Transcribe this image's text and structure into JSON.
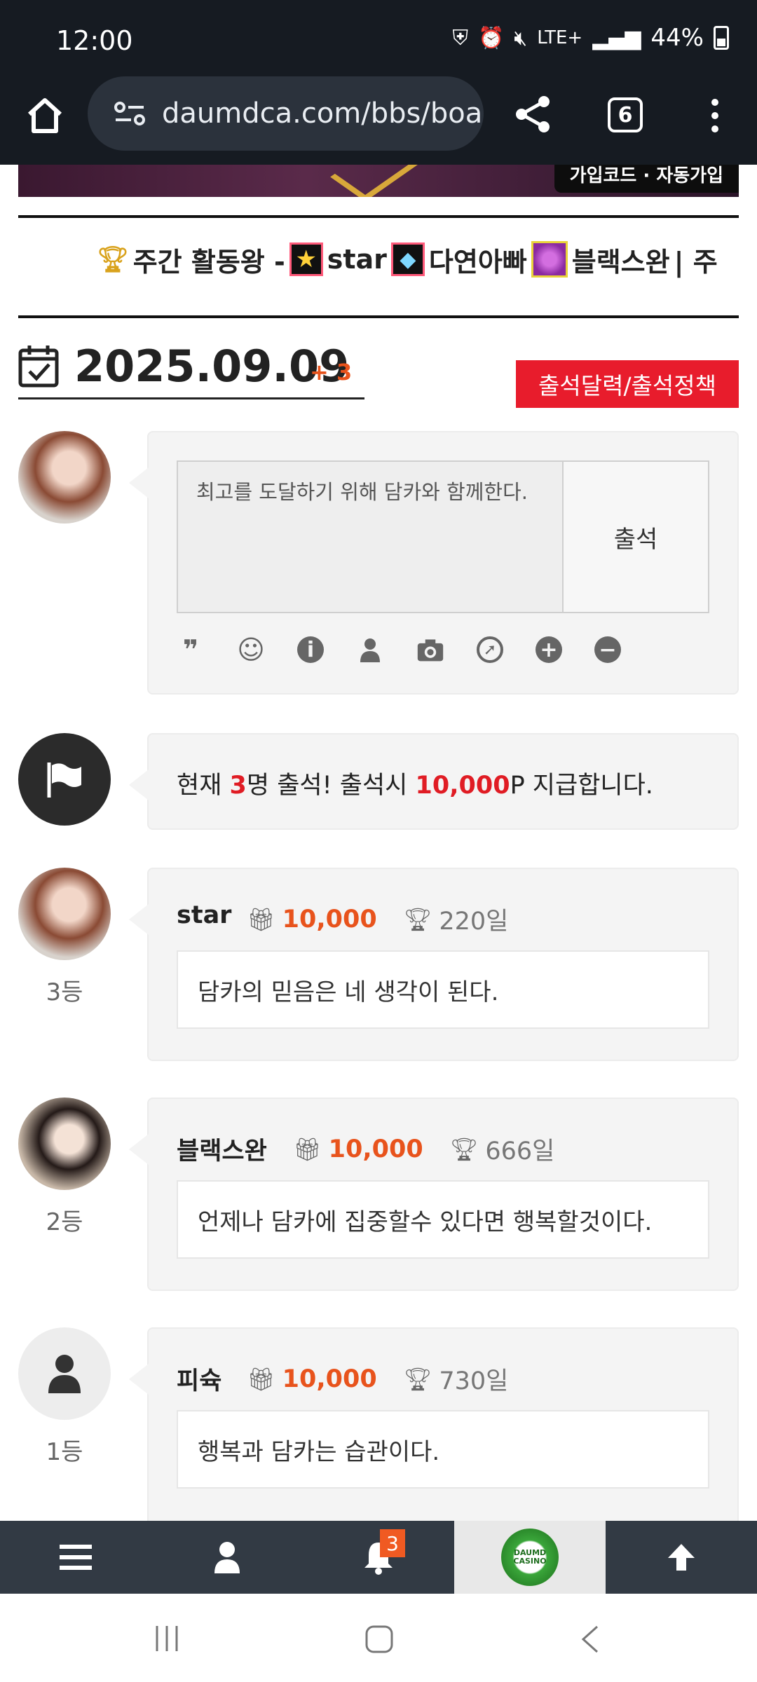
{
  "status": {
    "time": "12:00",
    "network": "LTE+",
    "battery": "44%"
  },
  "browser": {
    "url": "daumdca.com/bbs/boa",
    "tab_count": "6"
  },
  "banner": {
    "badge": "가입코드 · 자동가입"
  },
  "ticker": {
    "prefix": "주간 활동왕 -",
    "users": [
      "star",
      "다연아빠",
      "블랙스완"
    ],
    "separator": "| 주"
  },
  "attendance": {
    "date": "2025.09.09",
    "plus": "+ 3",
    "policy_button": "출석달력/출석정책",
    "composer_text": "최고를 도달하기 위해 담카와 함께한다.",
    "attend_button": "출석",
    "notice": {
      "pre": "현재 ",
      "count": "3",
      "mid": "명 출석! 출석시 ",
      "points": "10,000",
      "post": "P 지급합니다."
    }
  },
  "entries": [
    {
      "name": "star",
      "points": "10,000",
      "days": "220일",
      "message": "담카의 믿음은 네 생각이 된다.",
      "rank": "3등"
    },
    {
      "name": "블랙스완",
      "points": "10,000",
      "days": "666일",
      "message": "언제나 담카에 집중할수 있다면 행복할것이다.",
      "rank": "2등"
    },
    {
      "name": "피슉",
      "points": "10,000",
      "days": "730일",
      "message": "행복과 담카는 습관이다.",
      "rank": "1등"
    }
  ],
  "bottom_nav": {
    "notification_count": "3",
    "logo_text": "DAUMD CASINO"
  },
  "colors": {
    "accent_red": "#e81c2c",
    "points_orange": "#e8531c",
    "nav_bg": "#323a44"
  }
}
